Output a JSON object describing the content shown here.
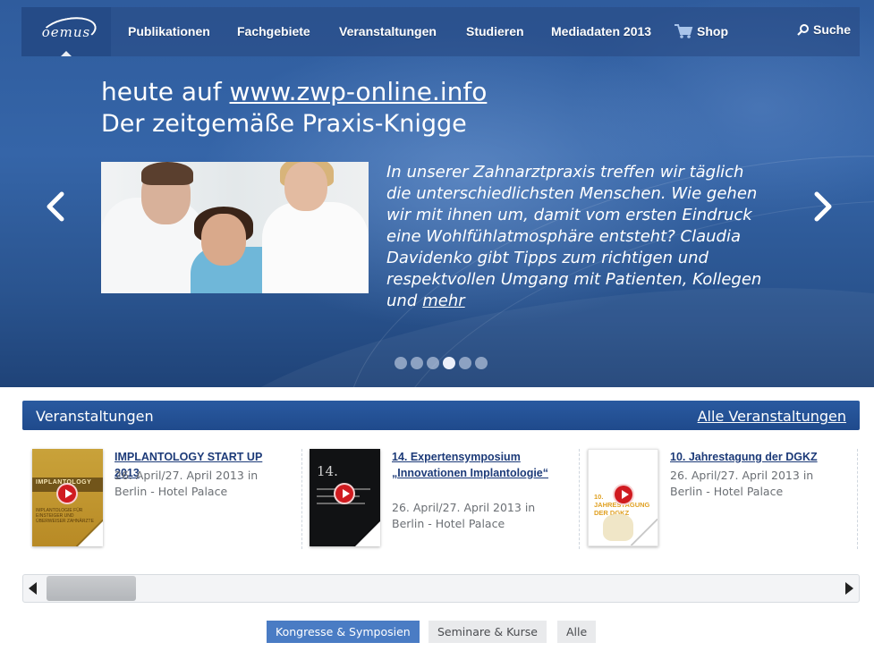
{
  "nav": {
    "logo": "oemus",
    "items": [
      "Publikationen",
      "Fachgebiete",
      "Veranstaltungen",
      "Studieren",
      "Mediadaten 2013"
    ],
    "shop": "Shop",
    "search": "Suche"
  },
  "slider": {
    "title_prefix": "heute auf",
    "title_link": "www.zwp-online.info",
    "subtitle": "Der zeitgemäße Praxis-Knigge",
    "text": "In unserer Zahnarztpraxis treffen wir täglich die unterschiedlichsten Menschen. Wie gehen wir mit ihnen um, damit vom ersten Eindruck eine Wohlfühlatmosphäre entsteht? Claudia Davidenko gibt Tipps zum richtigen und respektvollen Umgang mit Patienten, Kollegen und",
    "more": "mehr",
    "dot_count": 6,
    "active_dot": 4
  },
  "events": {
    "title": "Veranstaltungen",
    "all_link": "Alle Veranstaltungen",
    "items": [
      {
        "title": "IMPLANTOLOGY START UP 2013",
        "desc": "26. April/27. April 2013 in Berlin - Hotel Palace",
        "thumb_band": "IMPLANTOLOGY",
        "thumb_sub": "IMPLANTOLOGIE FÜR EINSTEIGER UND ÜBERWEISER ZAHNÄRZTE"
      },
      {
        "title": "14. Expertensymposium „Innovationen Implantologie“",
        "desc": "26. April/27. April 2013 in Berlin - Hotel Palace",
        "thumb_num": "14."
      },
      {
        "title": "10. Jahrestagung der DGKZ",
        "desc": "26. April/27. April 2013 in Berlin - Hotel Palace",
        "thumb_title": "10. JAHRESTAGUNG DER DGKZ"
      }
    ]
  },
  "filters": [
    {
      "label": "Kongresse & Symposien",
      "active": true
    },
    {
      "label": "Seminare & Kurse",
      "active": false
    },
    {
      "label": "Alle",
      "active": false
    }
  ],
  "colors": {
    "hero": "#2f5c9d",
    "events_header": "#2a5aa0",
    "filter_active": "#4a7cc4",
    "event_title": "#1c3a78",
    "play_button": "#d01b20"
  }
}
